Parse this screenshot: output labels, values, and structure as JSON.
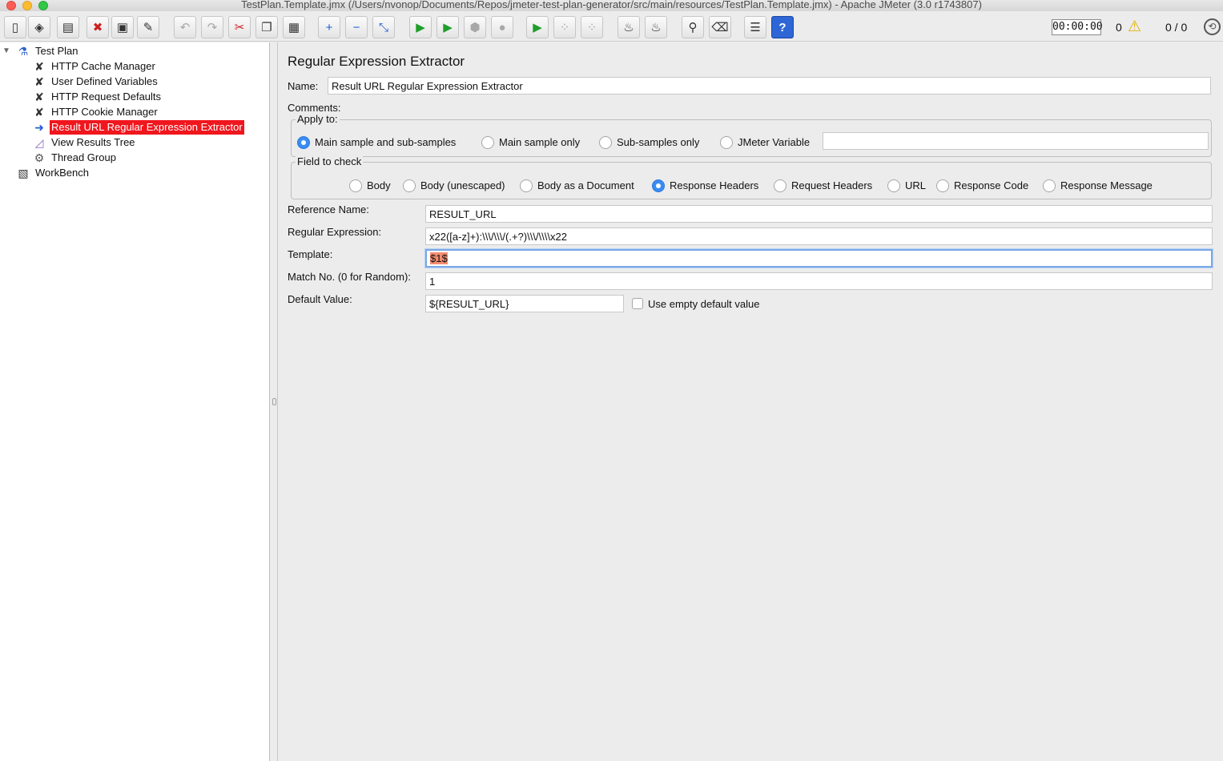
{
  "window": {
    "title": "TestPlan.Template.jmx (/Users/nvonop/Documents/Repos/jmeter-test-plan-generator/src/main/resources/TestPlan.Template.jmx) - Apache JMeter (3.0 r1743807)"
  },
  "toolbar": {
    "buttons": [
      {
        "name": "new-icon",
        "glyph": "▯"
      },
      {
        "name": "templates-icon",
        "glyph": "◈"
      },
      {
        "name": "open-icon",
        "glyph": "▤"
      },
      {
        "name": "close-icon",
        "glyph": "✖"
      },
      {
        "name": "save-icon",
        "glyph": "▣"
      },
      {
        "name": "save-as-icon",
        "glyph": "✎"
      },
      {
        "name": "undo-icon",
        "glyph": "↶"
      },
      {
        "name": "redo-icon",
        "glyph": "↷"
      },
      {
        "name": "cut-icon",
        "glyph": "✂"
      },
      {
        "name": "copy-icon",
        "glyph": "❐"
      },
      {
        "name": "paste-icon",
        "glyph": "▦"
      },
      {
        "name": "expand-icon",
        "glyph": "+"
      },
      {
        "name": "collapse-icon",
        "glyph": "−"
      },
      {
        "name": "toggle-icon",
        "glyph": "⤡"
      },
      {
        "name": "start-icon",
        "glyph": "▶"
      },
      {
        "name": "start-no-pauses-icon",
        "glyph": "▶"
      },
      {
        "name": "stop-icon",
        "glyph": "⬢"
      },
      {
        "name": "shutdown-icon",
        "glyph": "●"
      },
      {
        "name": "remote-start-icon",
        "glyph": "▶"
      },
      {
        "name": "remote-stop-icon",
        "glyph": "⁘"
      },
      {
        "name": "remote-shutdown-icon",
        "glyph": "⁘"
      },
      {
        "name": "clear-icon",
        "glyph": "♨"
      },
      {
        "name": "clear-all-icon",
        "glyph": "♨"
      },
      {
        "name": "search-icon",
        "glyph": "⚲"
      },
      {
        "name": "reset-search-icon",
        "glyph": "⌫"
      },
      {
        "name": "function-helper-icon",
        "glyph": "☰"
      },
      {
        "name": "help-icon",
        "glyph": "?"
      }
    ],
    "timer": "00:00:00",
    "warning_count": "0",
    "warning_icon": "⚠",
    "threads": "0 / 0"
  },
  "tree": {
    "nodes": [
      {
        "label": "Test Plan",
        "icon": "flask-icon",
        "glyph": "⚗"
      },
      {
        "label": "HTTP Cache Manager",
        "icon": "tools-icon",
        "glyph": "✘"
      },
      {
        "label": "User Defined Variables",
        "icon": "tools-icon",
        "glyph": "✘"
      },
      {
        "label": "HTTP Request Defaults",
        "icon": "tools-icon",
        "glyph": "✘"
      },
      {
        "label": "HTTP Cookie Manager",
        "icon": "tools-icon",
        "glyph": "✘"
      },
      {
        "label": "Result URL Regular Expression Extractor",
        "icon": "extractor-icon",
        "glyph": "➜"
      },
      {
        "label": "View Results Tree",
        "icon": "graph-icon",
        "glyph": "◿"
      },
      {
        "label": "Thread Group",
        "icon": "gear-icon",
        "glyph": "⚙"
      },
      {
        "label": "WorkBench",
        "icon": "workbench-icon",
        "glyph": "▧"
      }
    ]
  },
  "panel": {
    "title": "Regular Expression Extractor",
    "name_label": "Name:",
    "name_value": "Result URL Regular Expression Extractor",
    "comments_label": "Comments:",
    "apply_to": {
      "title": "Apply to:",
      "options": [
        "Main sample and sub-samples",
        "Main sample only",
        "Sub-samples only",
        "JMeter Variable"
      ],
      "selected": "Main sample and sub-samples",
      "variable_value": ""
    },
    "field_to_check": {
      "title": "Field to check",
      "options": [
        "Body",
        "Body (unescaped)",
        "Body as a Document",
        "Response Headers",
        "Request Headers",
        "URL",
        "Response Code",
        "Response Message"
      ],
      "selected": "Response Headers"
    },
    "reference_name_label": "Reference Name:",
    "reference_name_value": "RESULT_URL",
    "regex_label": "Regular Expression:",
    "regex_value": "x22([a-z]+):\\\\\\/\\\\\\/(.+?)\\\\\\/\\\\\\\\x22",
    "template_label": "Template:",
    "template_value": "$1$",
    "match_no_label": "Match No. (0 for Random):",
    "match_no_value": "1",
    "default_value_label": "Default Value:",
    "default_value_value": "${RESULT_URL}",
    "use_empty_default_label": "Use empty default value",
    "use_empty_default_checked": false
  }
}
